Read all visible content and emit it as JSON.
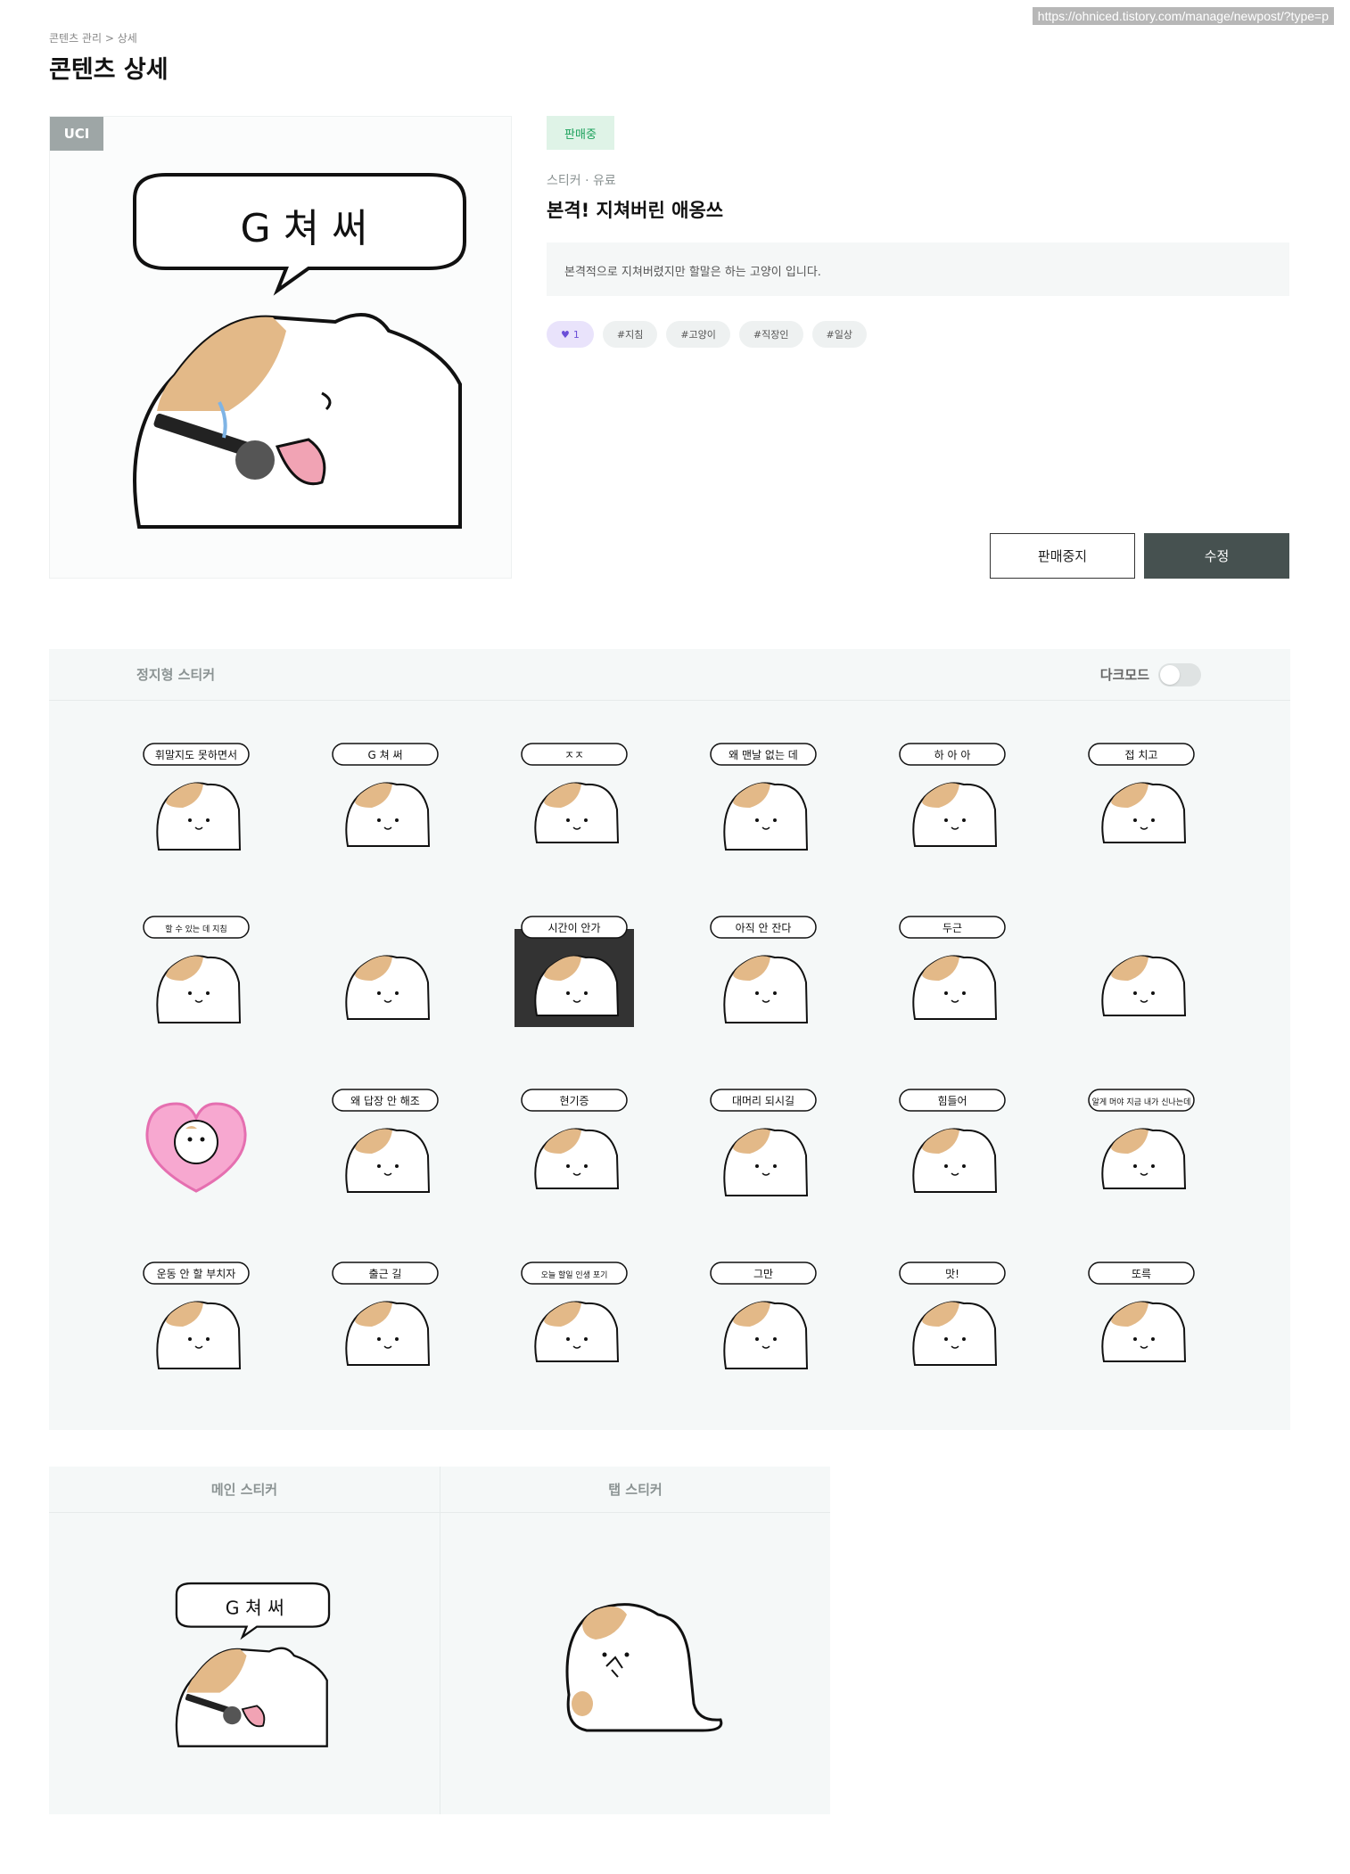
{
  "url": "https://ohniced.tistory.com/manage/newpost/?type=p",
  "breadcrumb": "콘텐츠 관리 > 상세",
  "page_title": "콘텐츠 상세",
  "hero_badge": "UCI",
  "status": "판매중",
  "category": "스티커 · 유료",
  "title": "본격! 지쳐버린 애옹쓰",
  "description": "본격적으로 지쳐버렸지만 할말은 하는 고양이 입니다.",
  "like_count": "1",
  "tags": [
    "#지침",
    "#고양이",
    "#직장인",
    "#일상"
  ],
  "buttons": {
    "stop": "판매중지",
    "edit": "수정"
  },
  "sticker_panel": {
    "label": "정지형 스티커",
    "dark_mode_label": "다크모드",
    "dark_mode_on": false
  },
  "stickers": [
    {
      "caption": "휘말지도 못하면서"
    },
    {
      "caption": "G 쳐 써"
    },
    {
      "caption": "ㅈㅈ"
    },
    {
      "caption": "왜 맨날 없는 데"
    },
    {
      "caption": "하 아 아"
    },
    {
      "caption": "접 치고"
    },
    {
      "caption": "할 수 있는 데 지침"
    },
    {
      "caption": ""
    },
    {
      "caption": "시간이 안가"
    },
    {
      "caption": "아직 안 잔다"
    },
    {
      "caption": "두근"
    },
    {
      "caption": ""
    },
    {
      "caption": ""
    },
    {
      "caption": "왜 답장 안 해조"
    },
    {
      "caption": "현기증"
    },
    {
      "caption": "대머리 되시길"
    },
    {
      "caption": "힘들어"
    },
    {
      "caption": "알게 머야 지금 내가 신나는데"
    },
    {
      "caption": "운동 안 할 부치자"
    },
    {
      "caption": "출근 길"
    },
    {
      "caption": "오늘 할일 인생 포기"
    },
    {
      "caption": "그만"
    },
    {
      "caption": "맛!"
    },
    {
      "caption": "또륵"
    }
  ],
  "main_sticker": {
    "label": "메인 스티커",
    "caption": "G 쳐 써"
  },
  "tab_sticker": {
    "label": "탭 스티커"
  },
  "colors": {
    "accent_dark": "#465150",
    "status_green": "#1aa05a",
    "like_purple": "#6b4fd8",
    "cat_orange": "#e3b988"
  }
}
